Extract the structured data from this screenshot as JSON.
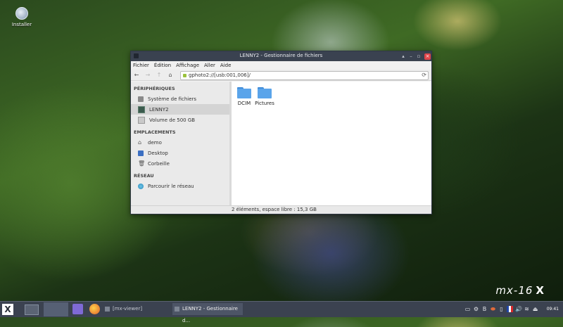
{
  "desktop": {
    "icon_label": "Installer"
  },
  "window": {
    "title": "LENNY2 - Gestionnaire de fichiers",
    "menu": [
      "Fichier",
      "Édition",
      "Affichage",
      "Aller",
      "Aide"
    ],
    "address": "gphoto2://[usb:001,006]/",
    "sidebar": {
      "devices_header": "PÉRIPHÉRIQUES",
      "devices": [
        "Système de fichiers",
        "LENNY2",
        "Volume de 500 GB"
      ],
      "places_header": "EMPLACEMENTS",
      "places": [
        "demo",
        "Desktop",
        "Corbeille"
      ],
      "network_header": "RÉSEAU",
      "network": [
        "Parcourir le réseau"
      ]
    },
    "files": [
      "DCIM",
      "Pictures"
    ],
    "status": "2 éléments, espace libre : 15,3 GB"
  },
  "brand": {
    "text": "mx-16",
    "mark": "X"
  },
  "taskbar": {
    "tasks": [
      "[mx-viewer]",
      "LENNY2 - Gestionnaire d..."
    ],
    "clock": "09:41"
  },
  "icons": {
    "back": "←",
    "forward": "→",
    "up": "↑",
    "home": "⌂",
    "reload": "⟳",
    "minimize": "▴",
    "restore": "–",
    "maximize": "▫",
    "close": "×",
    "trash": "🗑",
    "house": "⌂",
    "tray": [
      "▭",
      "⚙",
      "B",
      "⬬",
      "▯",
      "■",
      "🔊",
      "≋",
      "⏏"
    ]
  },
  "colors": {
    "accent": "#e0454a",
    "titlebar": "#3a4250",
    "taskbar": "#3b4250",
    "folder": "#5aa4ea"
  }
}
